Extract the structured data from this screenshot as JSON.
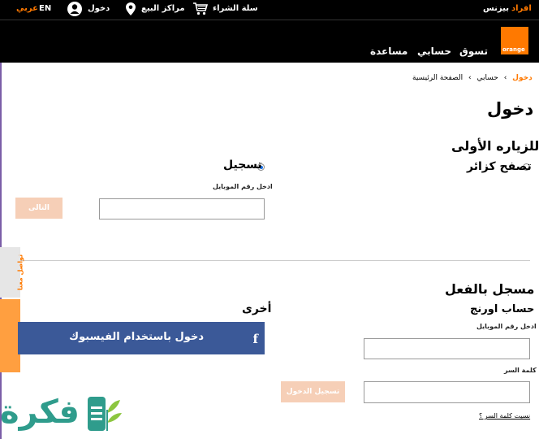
{
  "topbar": {
    "lang_ar": "عربي",
    "lang_en": "EN",
    "login": "دخول",
    "stores": "مراكز البيع",
    "cart": "سلة الشراء",
    "individuals": "افراد",
    "business": "بيزنس"
  },
  "logo": {
    "text": "orange"
  },
  "nav": {
    "shop": "تسوق",
    "account": "حسابي",
    "help": "مساعدة"
  },
  "breadcrumb": {
    "home": "الصفحة الرئيسية",
    "account": "حسابي",
    "login": "دخول",
    "separator": "›"
  },
  "page": {
    "title": "دخول",
    "first_visit": "للزياره الأولى",
    "guest_option": "تصفح كزائر",
    "register_option": "تسجيل",
    "register_mobile_label": "ادخل رقم الموبايل",
    "next_button": "التالى",
    "registered_title": "مسجل بالفعل",
    "orange_account": "حساب اورنج",
    "mobile_label": "ادخل رقم الموبايل",
    "password_label": "كلمة السر",
    "login_button": "تسجيل الدخول",
    "forgot_password": "نسيت كلمة السر ؟",
    "other_title": "أخرى",
    "facebook_button": "دخول باستخدام الفيسبوك",
    "facebook_icon_glyph": "f"
  },
  "side_tabs": {
    "contact": "تواصل معنا",
    "feedback": "ساعدنا في التطوير"
  },
  "watermark": {
    "text": "فكرة"
  },
  "colors": {
    "brand_orange": "#ff7900",
    "facebook_blue": "#3b5998",
    "button_disabled": "#f6cfb7",
    "watermark_green": "#2f9c8c"
  },
  "icons": {
    "user": "user-icon",
    "location": "location-pin-icon",
    "cart": "cart-icon",
    "facebook": "facebook-icon"
  }
}
